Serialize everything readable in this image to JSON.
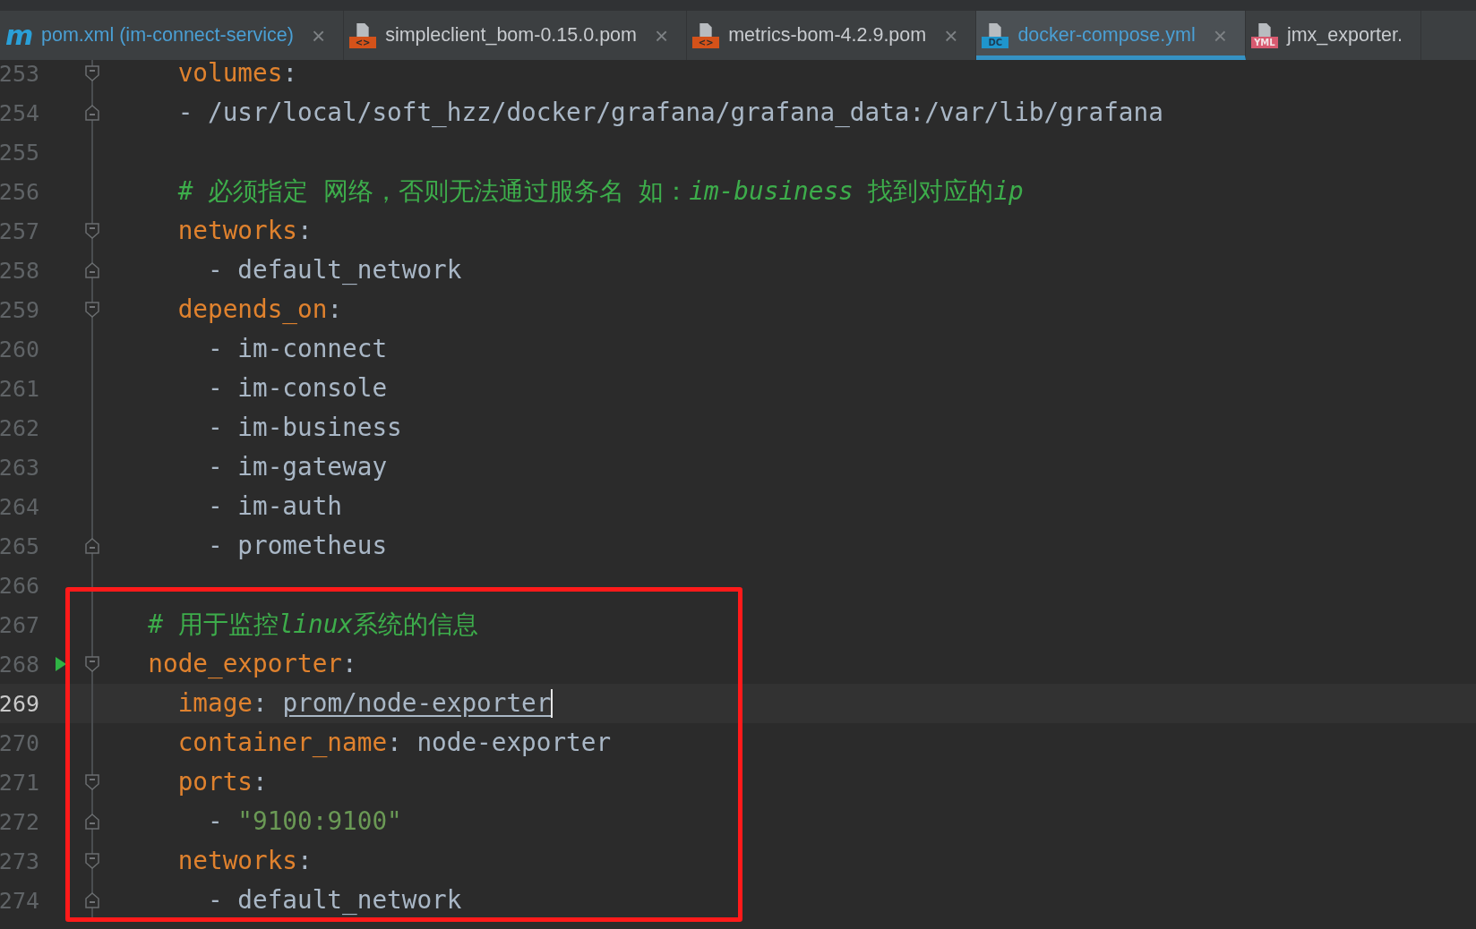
{
  "tabs": [
    {
      "label": "pom.xml (im-connect-service)",
      "kind": "maven",
      "icon_text": "m",
      "selected": false,
      "color": "#4a9fd4",
      "close_glyph": "×"
    },
    {
      "label": "simpleclient_bom-0.15.0.pom",
      "kind": "xml",
      "icon_text": "<>",
      "selected": false,
      "color": "#c8cbcf",
      "close_glyph": "×"
    },
    {
      "label": "metrics-bom-4.2.9.pom",
      "kind": "xml",
      "icon_text": "<>",
      "selected": false,
      "color": "#c8cbcf",
      "close_glyph": "×"
    },
    {
      "label": "docker-compose.yml",
      "kind": "dc",
      "icon_text": "DC",
      "selected": true,
      "color": "#4a9fd4",
      "close_glyph": "×"
    },
    {
      "label": "jmx_exporter.",
      "kind": "yml",
      "icon_text": "YML",
      "selected": false,
      "color": "#c8cbcf"
    }
  ],
  "editor": {
    "lines": [
      {
        "number": "253",
        "fold_open": true,
        "segments": [
          {
            "kind": "key",
            "text": "    volumes"
          },
          {
            "kind": "punct",
            "text": ":"
          }
        ]
      },
      {
        "number": "254",
        "fold_close": true,
        "segments": [
          {
            "kind": "plain",
            "text": "    - /usr/local/soft_hzz/docker/grafana/grafana_data:/var/lib/grafana"
          }
        ]
      },
      {
        "number": "255"
      },
      {
        "number": "256",
        "segments": [
          {
            "kind": "comment",
            "parts": [
              {
                "text": "    # 必须指定 网络，否则无法通过服务名 如：",
                "italic": false
              },
              {
                "text": "im-business",
                "italic": true
              },
              {
                "text": " 找到对应的",
                "italic": false
              },
              {
                "text": "ip",
                "italic": true
              }
            ]
          }
        ]
      },
      {
        "number": "257",
        "fold_open": true,
        "segments": [
          {
            "kind": "key",
            "text": "    networks"
          },
          {
            "kind": "punct",
            "text": ":"
          }
        ]
      },
      {
        "number": "258",
        "fold_close": true,
        "segments": [
          {
            "kind": "plain",
            "text": "      - default_network"
          }
        ]
      },
      {
        "number": "259",
        "fold_open": true,
        "segments": [
          {
            "kind": "key",
            "text": "    depends_on"
          },
          {
            "kind": "punct",
            "text": ":"
          }
        ]
      },
      {
        "number": "260",
        "segments": [
          {
            "kind": "plain",
            "text": "      - im-connect"
          }
        ]
      },
      {
        "number": "261",
        "segments": [
          {
            "kind": "plain",
            "text": "      - im-console"
          }
        ]
      },
      {
        "number": "262",
        "segments": [
          {
            "kind": "plain",
            "text": "      - im-business"
          }
        ]
      },
      {
        "number": "263",
        "segments": [
          {
            "kind": "plain",
            "text": "      - im-gateway"
          }
        ]
      },
      {
        "number": "264",
        "segments": [
          {
            "kind": "plain",
            "text": "      - im-auth"
          }
        ]
      },
      {
        "number": "265",
        "fold_close": true,
        "segments": [
          {
            "kind": "plain",
            "text": "      - prometheus"
          }
        ]
      },
      {
        "number": "266"
      }
    ],
    "framed": {
      "kind": "frame",
      "color": "#ff1a1a",
      "lines": [
        {
          "number": "267",
          "segments": [
            {
              "kind": "comment",
              "parts": [
                {
                  "text": "  # 用于监控",
                  "italic": false
                },
                {
                  "text": "linux",
                  "italic": true
                },
                {
                  "text": "系统的信息",
                  "italic": false
                }
              ]
            }
          ]
        },
        {
          "number": "268",
          "fold_open": true,
          "run_marker": true,
          "segments": [
            {
              "kind": "key",
              "text": "  node_exporter"
            },
            {
              "kind": "punct",
              "text": ":"
            }
          ]
        },
        {
          "number": "269",
          "current": true,
          "caret": true,
          "segments": [
            {
              "kind": "key",
              "text": "    image"
            },
            {
              "kind": "punct",
              "text": ": "
            },
            {
              "kind": "link",
              "text": "prom/node-exporter"
            }
          ]
        },
        {
          "number": "270",
          "segments": [
            {
              "kind": "key",
              "text": "    container_name"
            },
            {
              "kind": "punct",
              "text": ": "
            },
            {
              "kind": "plain",
              "text": "node-exporter"
            }
          ]
        },
        {
          "number": "271",
          "fold_open": true,
          "segments": [
            {
              "kind": "key",
              "text": "    ports"
            },
            {
              "kind": "punct",
              "text": ":"
            }
          ]
        },
        {
          "number": "272",
          "fold_close": true,
          "segments": [
            {
              "kind": "plain",
              "text": "      - "
            },
            {
              "kind": "string",
              "text": "\"9100:9100\""
            }
          ]
        },
        {
          "number": "273",
          "fold_open": true,
          "segments": [
            {
              "kind": "key",
              "text": "    networks"
            },
            {
              "kind": "punct",
              "text": ":"
            }
          ]
        },
        {
          "number": "274",
          "fold_close": true,
          "segments": [
            {
              "kind": "plain",
              "text": "      - default_network"
            }
          ]
        }
      ]
    }
  }
}
